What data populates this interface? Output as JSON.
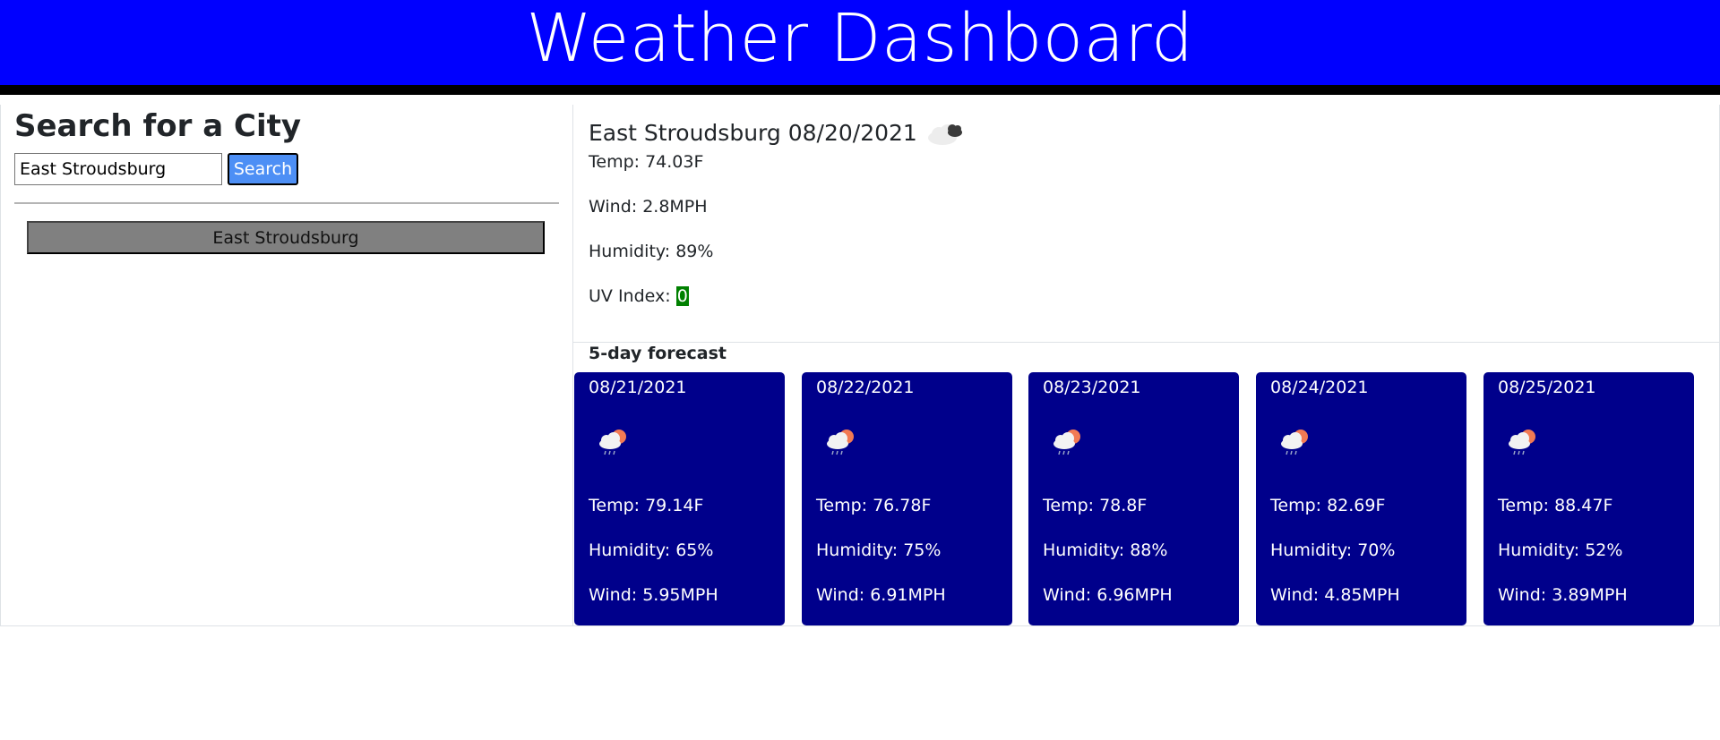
{
  "header": {
    "title": "Weather Dashboard"
  },
  "search": {
    "heading": "Search for a City",
    "input_value": "East Stroudsburg",
    "button_label": "Search"
  },
  "history": {
    "items": [
      "East Stroudsburg"
    ]
  },
  "current": {
    "city": "East Stroudsburg",
    "date": "08/20/2021",
    "icon": "cloudy-icon",
    "temp": "Temp: 74.03F",
    "wind": "Wind: 2.8MPH",
    "humidity": "Humidity: 89%",
    "uv_label": "UV Index: ",
    "uv_value": "0",
    "uv_color": "#008000"
  },
  "forecast": {
    "label": "5-day forecast",
    "card_color": "#00008b",
    "days": [
      {
        "date": "08/21/2021",
        "icon": "rain-sun-cloud-icon",
        "temp": "Temp: 79.14F",
        "humidity": "Humidity: 65%",
        "wind": "Wind: 5.95MPH"
      },
      {
        "date": "08/22/2021",
        "icon": "rain-sun-cloud-icon",
        "temp": "Temp: 76.78F",
        "humidity": "Humidity: 75%",
        "wind": "Wind: 6.91MPH"
      },
      {
        "date": "08/23/2021",
        "icon": "rain-sun-cloud-icon",
        "temp": "Temp: 78.8F",
        "humidity": "Humidity: 88%",
        "wind": "Wind: 6.96MPH"
      },
      {
        "date": "08/24/2021",
        "icon": "rain-sun-cloud-icon",
        "temp": "Temp: 82.69F",
        "humidity": "Humidity: 70%",
        "wind": "Wind: 4.85MPH"
      },
      {
        "date": "08/25/2021",
        "icon": "rain-sun-cloud-icon",
        "temp": "Temp: 88.47F",
        "humidity": "Humidity: 52%",
        "wind": "Wind: 3.89MPH"
      }
    ]
  },
  "colors": {
    "header_bg": "#0000ff",
    "search_button": "#4d8ff5",
    "history_button": "#808080"
  }
}
